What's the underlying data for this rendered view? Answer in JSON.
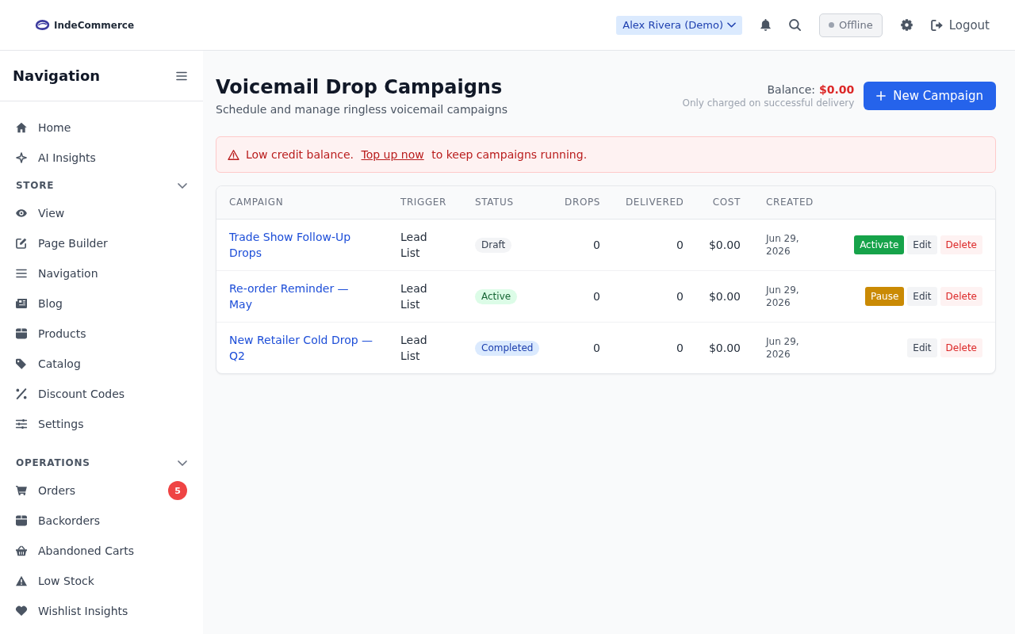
{
  "header": {
    "brand": "IndeCommerce",
    "user_menu": "Alex Rivera (Demo)",
    "connection_status": "Offline",
    "logout": "Logout"
  },
  "sidebar": {
    "title": "Navigation",
    "items": [
      {
        "label": "Home"
      },
      {
        "label": "AI Insights"
      }
    ],
    "sections": [
      {
        "label": "STORE",
        "expanded": true,
        "items": [
          {
            "label": "View"
          },
          {
            "label": "Page Builder"
          },
          {
            "label": "Navigation"
          },
          {
            "label": "Blog"
          },
          {
            "label": "Products"
          },
          {
            "label": "Catalog"
          },
          {
            "label": "Discount Codes"
          },
          {
            "label": "Settings"
          }
        ]
      },
      {
        "label": "OPERATIONS",
        "expanded": true,
        "items": [
          {
            "label": "Orders",
            "badge": "5"
          },
          {
            "label": "Backorders"
          },
          {
            "label": "Abandoned Carts"
          },
          {
            "label": "Low Stock"
          },
          {
            "label": "Wishlist Insights"
          }
        ]
      }
    ]
  },
  "page": {
    "title": "Voicemail Drop Campaigns",
    "subtitle": "Schedule and manage ringless voicemail campaigns",
    "balance_label": "Balance:",
    "balance_amount": "$0.00",
    "balance_note": "Only charged on successful delivery",
    "new_button": "New Campaign"
  },
  "alert": {
    "message": "Low credit balance.",
    "link": "Top up now",
    "message_end": "to keep campaigns running."
  },
  "table": {
    "columns": [
      "CAMPAIGN",
      "TRIGGER",
      "STATUS",
      "DROPS",
      "DELIVERED",
      "COST",
      "CREATED"
    ],
    "rows": [
      {
        "campaign": "Trade Show Follow-Up Drops",
        "trigger": "Lead List",
        "status": {
          "label": "Draft",
          "kind": "draft"
        },
        "drops": "0",
        "delivered": "0",
        "cost": "$0.00",
        "created": "Jun 29, 2026",
        "actions": [
          {
            "label": "Activate",
            "kind": "activate"
          },
          {
            "label": "Edit",
            "kind": "edit"
          },
          {
            "label": "Delete",
            "kind": "delete"
          }
        ]
      },
      {
        "campaign": "Re-order Reminder — May",
        "trigger": "Lead List",
        "status": {
          "label": "Active",
          "kind": "active"
        },
        "drops": "0",
        "delivered": "0",
        "cost": "$0.00",
        "created": "Jun 29, 2026",
        "actions": [
          {
            "label": "Pause",
            "kind": "pause"
          },
          {
            "label": "Edit",
            "kind": "edit"
          },
          {
            "label": "Delete",
            "kind": "delete"
          }
        ]
      },
      {
        "campaign": "New Retailer Cold Drop — Q2",
        "trigger": "Lead List",
        "status": {
          "label": "Completed",
          "kind": "completed"
        },
        "drops": "0",
        "delivered": "0",
        "cost": "$0.00",
        "created": "Jun 29, 2026",
        "actions": [
          {
            "label": "Edit",
            "kind": "edit"
          },
          {
            "label": "Delete",
            "kind": "delete"
          }
        ]
      }
    ]
  }
}
